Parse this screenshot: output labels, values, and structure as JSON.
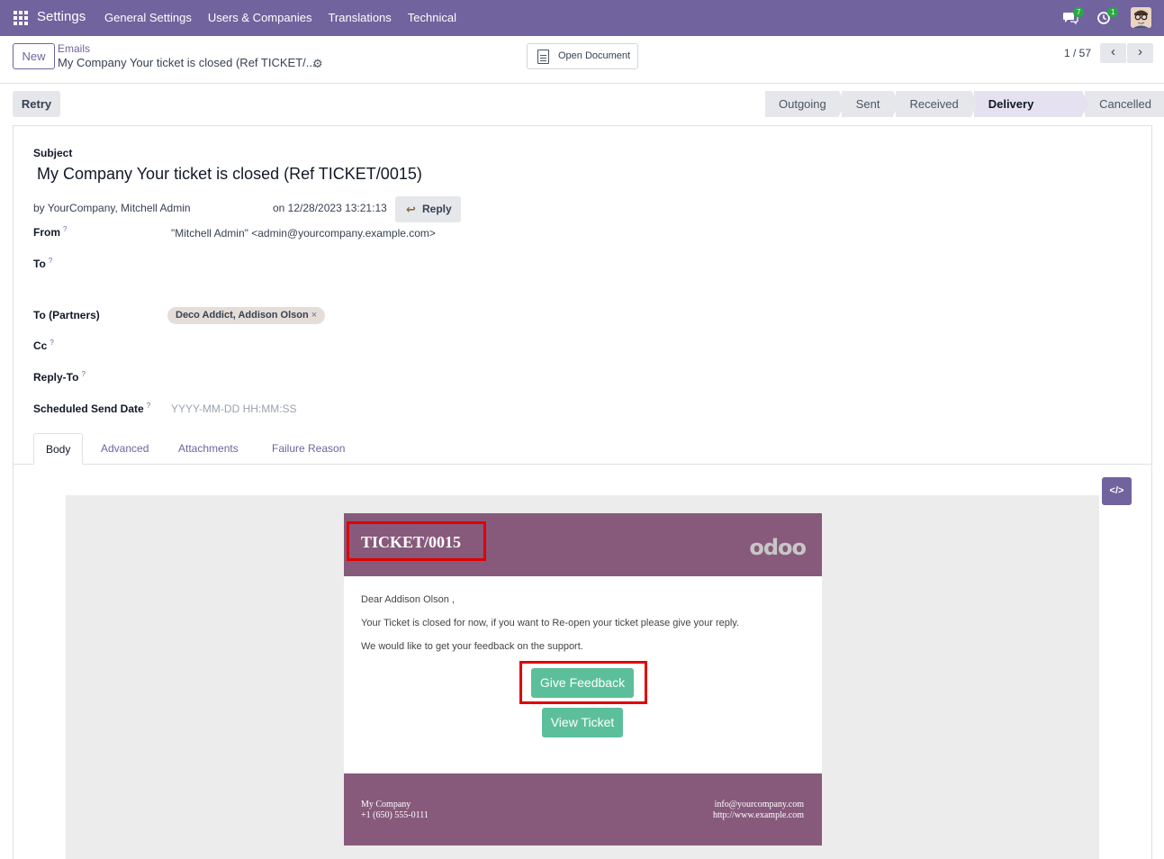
{
  "navbar": {
    "brand": "Settings",
    "menu": [
      "General Settings",
      "Users & Companies",
      "Translations",
      "Technical"
    ],
    "messages_count": "7",
    "activities_count": "1",
    "color": "#71639e"
  },
  "control_panel": {
    "new_label": "New",
    "breadcrumb_parent": "Emails",
    "breadcrumb_current": "My Company Your ticket is closed (Ref TICKET/...",
    "open_document_label": "Open Document",
    "pager_value": "1 / 57"
  },
  "statusbar": {
    "retry_label": "Retry",
    "stages": [
      "Outgoing",
      "Sent",
      "Received",
      "Delivery Failed",
      "Cancelled"
    ],
    "active_stage": "Delivery Failed"
  },
  "form": {
    "subject_label": "Subject",
    "subject_value": "My Company Your ticket is closed (Ref TICKET/0015)",
    "by_text": "by  YourCompany, Mitchell Admin",
    "date_text": "on 12/28/2023 13:21:13",
    "reply_label": "Reply",
    "from_label": "From",
    "from_value": "\"Mitchell Admin\" <admin@yourcompany.example.com>",
    "to_label": "To",
    "to_partners_label": "To (Partners)",
    "to_partners_tag": "Deco Addict, Addison Olson",
    "cc_label": "Cc",
    "reply_to_label": "Reply-To",
    "scheduled_label": "Scheduled Send Date",
    "scheduled_placeholder": "YYYY-MM-DD HH:MM:SS",
    "help_mark": "?"
  },
  "tabs": [
    "Body",
    "Advanced",
    "Attachments",
    "Failure Reason"
  ],
  "active_tab": "Body",
  "email": {
    "ticket_ref": "TICKET/0015",
    "logo_text": "odoo",
    "greeting": "Dear Addison Olson ,",
    "line1": "Your Ticket is closed for now, if you want to Re-open your ticket please give your reply.",
    "line2": "We would like to get your feedback on the support.",
    "feedback_button": "Give Feedback",
    "view_button": "View Ticket",
    "footer_company": "My Company",
    "footer_phone": "+1 (650) 555-0111",
    "footer_email": "info@yourcompany.com",
    "footer_website": "http://www.example.com",
    "header_color": "#875a7b",
    "button_color": "#5cbf9b",
    "highlight_color": "#e10000"
  }
}
